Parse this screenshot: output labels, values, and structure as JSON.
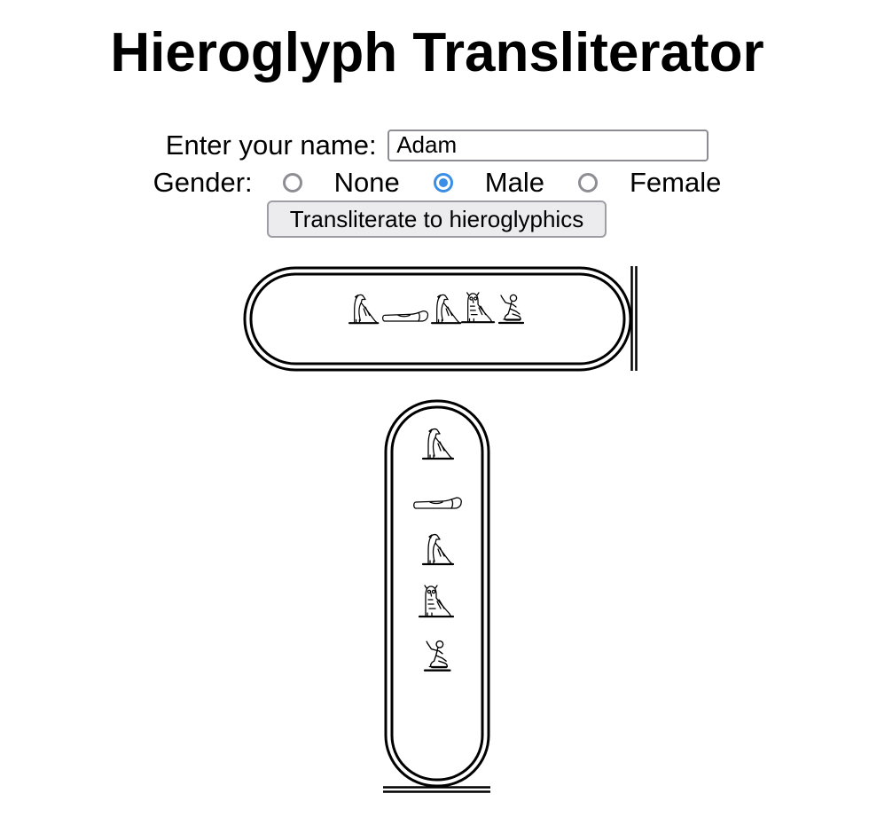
{
  "page": {
    "title": "Hieroglyph Transliterator"
  },
  "form": {
    "name_label": "Enter your name:",
    "name_value": "Adam",
    "gender_label": "Gender:",
    "gender_options": [
      "None",
      "Male",
      "Female"
    ],
    "gender_selected": "Male",
    "submit_label": "Transliterate to hieroglyphics"
  },
  "cartouche": {
    "glyphs": [
      "vulture-glyph",
      "hand-glyph",
      "vulture-glyph",
      "owl-glyph",
      "seated-man-glyph"
    ]
  },
  "colors": {
    "accent": "#3a8ee6",
    "ink": "#000000"
  }
}
